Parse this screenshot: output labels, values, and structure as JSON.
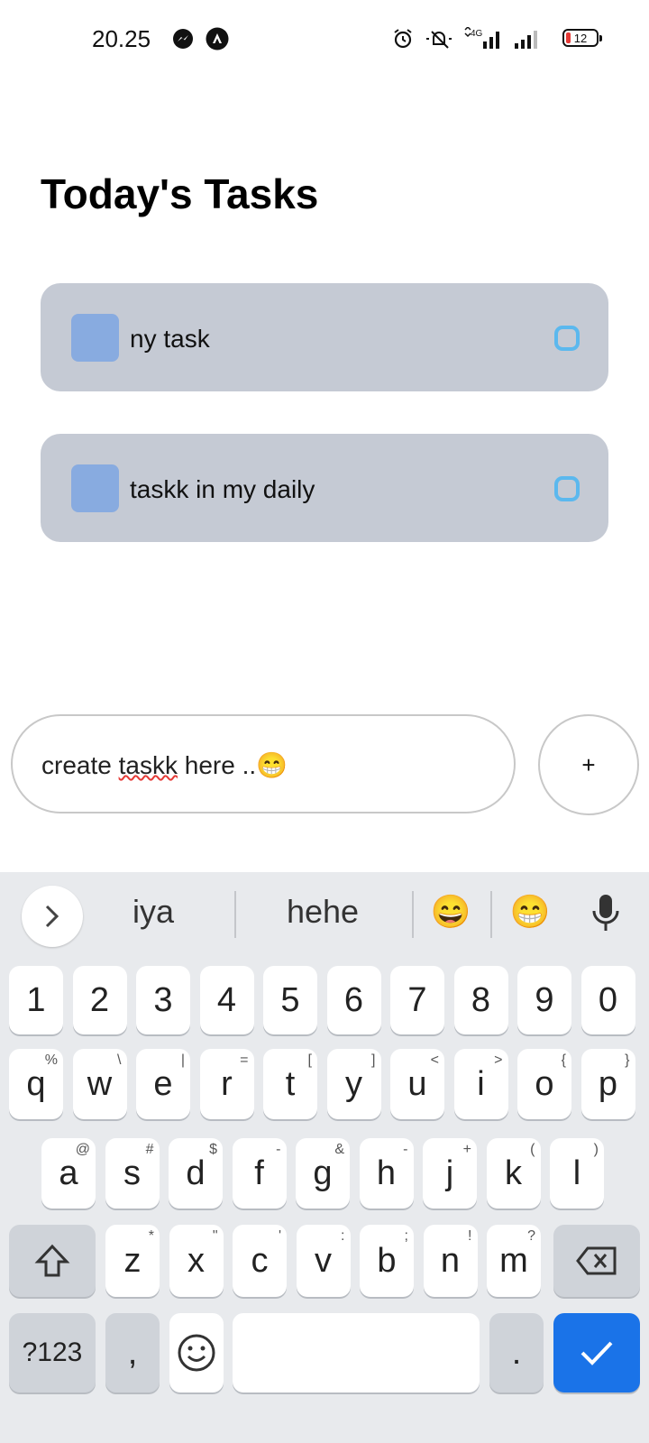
{
  "status_bar": {
    "time": "20.25",
    "battery": "12",
    "icons": [
      "messenger-icon",
      "app-icon",
      "alarm-icon",
      "silent-icon",
      "4g-signal-icon",
      "signal-icon",
      "battery-icon"
    ]
  },
  "page": {
    "title": "Today's Tasks"
  },
  "tasks": [
    {
      "label": "ny task"
    },
    {
      "label": "taskk in my daily"
    }
  ],
  "composer": {
    "text_prefix": "create ",
    "text_misspelled": "taskk",
    "text_suffix": " here ..😁",
    "add_label": "+"
  },
  "keyboard": {
    "suggestions": [
      "iya",
      "hehe",
      "😄",
      "😁"
    ],
    "numbers": [
      "1",
      "2",
      "3",
      "4",
      "5",
      "6",
      "7",
      "8",
      "9",
      "0"
    ],
    "row1": [
      {
        "k": "q",
        "s": "%"
      },
      {
        "k": "w",
        "s": "\\"
      },
      {
        "k": "e",
        "s": "|"
      },
      {
        "k": "r",
        "s": "="
      },
      {
        "k": "t",
        "s": "["
      },
      {
        "k": "y",
        "s": "]"
      },
      {
        "k": "u",
        "s": "<"
      },
      {
        "k": "i",
        "s": ">"
      },
      {
        "k": "o",
        "s": "{"
      },
      {
        "k": "p",
        "s": "}"
      }
    ],
    "row2": [
      {
        "k": "a",
        "s": "@"
      },
      {
        "k": "s",
        "s": "#"
      },
      {
        "k": "d",
        "s": "$"
      },
      {
        "k": "f",
        "s": "-"
      },
      {
        "k": "g",
        "s": "&"
      },
      {
        "k": "h",
        "s": "-"
      },
      {
        "k": "j",
        "s": "+"
      },
      {
        "k": "k",
        "s": "("
      },
      {
        "k": "l",
        "s": ")"
      }
    ],
    "row3": [
      {
        "k": "z",
        "s": "*"
      },
      {
        "k": "x",
        "s": "\""
      },
      {
        "k": "c",
        "s": "'"
      },
      {
        "k": "v",
        "s": ":"
      },
      {
        "k": "b",
        "s": ";"
      },
      {
        "k": "n",
        "s": "!"
      },
      {
        "k": "m",
        "s": "?"
      }
    ],
    "sym_label": "?123",
    "comma": ",",
    "period": "."
  },
  "colors": {
    "task_card": "#c5cad4",
    "task_square": "#88abe0",
    "task_circle": "#5bb8ee",
    "enter_key": "#1a73e8",
    "keyboard_bg": "#e8eaed"
  }
}
